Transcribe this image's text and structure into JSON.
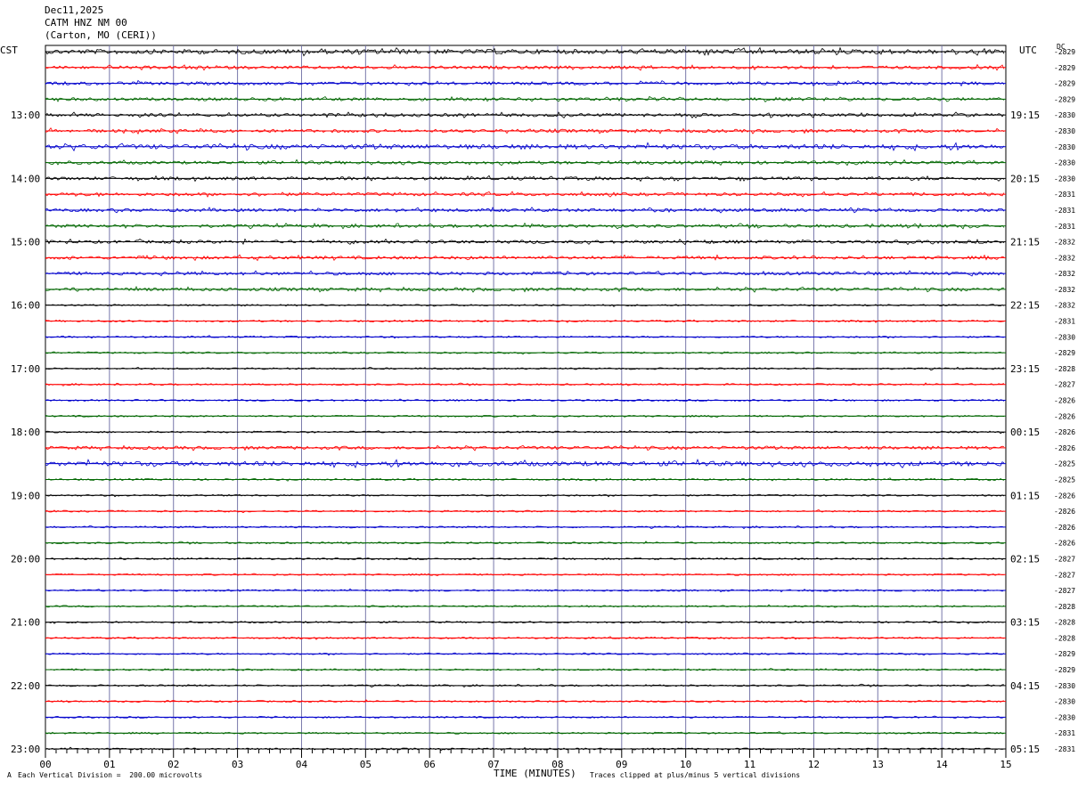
{
  "header": {
    "date": "Dec11,2025",
    "station": "CATM HNZ NM 00",
    "location": "(Carton, MO (CERI))"
  },
  "left_tz": "CST",
  "right_tz": "UTC",
  "dc_label": "DC",
  "footer": {
    "scale": "Each Vertical Division =  200.00 microvolts",
    "clip": "Traces clipped at plus/minus 5 vertical divisions",
    "corner": "A"
  },
  "colors": {
    "background": "#ffffff",
    "grid_vertical": "#7777aa",
    "trace_cycle": [
      "#000000",
      "#ff0000",
      "#0000cc",
      "#006600"
    ]
  },
  "chart_data": {
    "type": "line",
    "title": "Dec11,2025 CATM HNZ NM 00 (Carton, MO (CERI))",
    "xlabel": "TIME (MINUTES)",
    "xlim": [
      0,
      15
    ],
    "x_ticks": [
      "00",
      "01",
      "02",
      "03",
      "04",
      "05",
      "06",
      "07",
      "08",
      "09",
      "10",
      "11",
      "12",
      "13",
      "14",
      "15"
    ],
    "trace_minutes": 15,
    "left_hour_labels": [
      "13:00",
      "14:00",
      "15:00",
      "16:00",
      "17:00",
      "18:00",
      "19:00",
      "20:00",
      "21:00",
      "22:00",
      "23:00"
    ],
    "right_hour_labels": [
      "19:15",
      "20:15",
      "21:15",
      "22:15",
      "23:15",
      "00:15",
      "01:15",
      "02:15",
      "03:15",
      "04:15",
      "05:15"
    ],
    "dc_offsets": [
      -2829,
      -2829,
      -2829,
      -2829,
      -2830,
      -2830,
      -2830,
      -2830,
      -2830,
      -2831,
      -2831,
      -2831,
      -2832,
      -2832,
      -2832,
      -2832,
      -2832,
      -2831,
      -2830,
      -2829,
      -2828,
      -2827,
      -2826,
      -2826,
      -2826,
      -2826,
      -2825,
      -2825,
      -2826,
      -2826,
      -2826,
      -2826,
      -2827,
      -2827,
      -2827,
      -2828,
      -2828,
      -2828,
      -2829,
      -2829,
      -2830,
      -2830,
      -2830,
      -2831,
      -2831
    ],
    "activity": [
      3,
      2,
      2,
      2,
      2,
      2,
      3,
      2,
      2,
      2,
      2,
      2,
      2,
      2,
      2,
      2,
      1,
      1,
      1,
      1,
      1,
      1,
      1,
      1,
      1,
      2,
      3,
      1,
      1,
      1,
      1,
      1,
      1,
      1,
      1,
      1,
      1,
      1,
      1,
      1,
      1,
      1,
      1,
      1,
      1
    ]
  }
}
